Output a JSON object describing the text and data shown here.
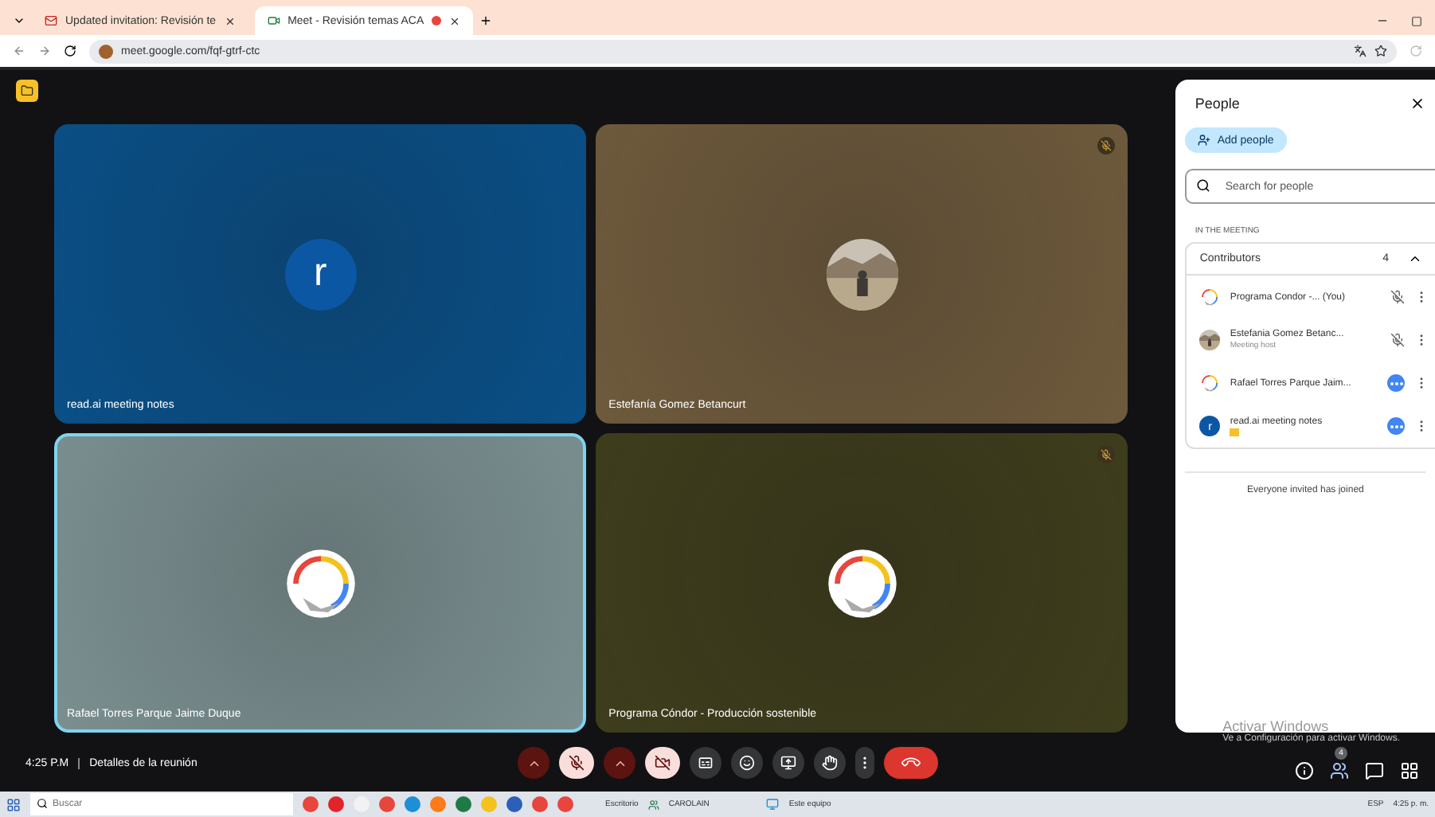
{
  "browser": {
    "tabs": [
      {
        "title": "Updated invitation: Revisión te",
        "selected": false
      },
      {
        "title": "Meet - Revisión temas ACA",
        "selected": true,
        "recording": true
      }
    ],
    "url": "meet.google.com/fqf-gtrf-ctc"
  },
  "tiles": [
    {
      "name": "read.ai meeting notes",
      "kind": "letter",
      "initial": "r",
      "active": false,
      "muted": false
    },
    {
      "name": "Estefanía Gomez Betancurt",
      "active": false,
      "muted": true
    },
    {
      "name": "Rafael Torres Parque Jaime Duque",
      "kind": "logo",
      "active": true,
      "muted": false
    },
    {
      "name": "Programa Cóndor - Producción sostenible",
      "kind": "logo",
      "active": false,
      "muted": true
    }
  ],
  "people_panel": {
    "title": "People",
    "add_button": "Add people",
    "search": {
      "placeholder": "Search for people"
    },
    "section": "IN THE MEETING",
    "group": {
      "label": "Contributors",
      "count": "4",
      "expanded": true
    },
    "participants": [
      {
        "name": "Programa Condor -...",
        "tag": "(You)",
        "kind": "logo",
        "muted": true,
        "speaking": false
      },
      {
        "name": "Estefania Gomez Betanc...",
        "subtitle": "Meeting host",
        "muted": true,
        "speaking": false
      },
      {
        "name": "Rafael Torres Parque Jaim...",
        "kind": "logo",
        "muted": false,
        "speaking": true
      },
      {
        "name": "read.ai meeting notes",
        "kind": "letter",
        "initial": "r",
        "muted": false,
        "speaking": true,
        "badge": true
      }
    ],
    "footer": "Everyone invited has joined"
  },
  "bottom_bar": {
    "time": "4:25 P.M",
    "details": "Detalles de la reunión",
    "controls": [
      {
        "kind": "caret",
        "alert": true
      },
      {
        "kind": "mic",
        "on": false
      },
      {
        "kind": "caret",
        "alert": true
      },
      {
        "kind": "camera",
        "on": false
      },
      {
        "kind": "captions"
      },
      {
        "kind": "emoji"
      },
      {
        "kind": "present"
      },
      {
        "kind": "hand"
      },
      {
        "kind": "more"
      },
      {
        "kind": "end"
      }
    ],
    "side_icons": [
      {
        "kind": "info",
        "selected": false
      },
      {
        "kind": "people",
        "selected": true,
        "badge": "4"
      },
      {
        "kind": "chat",
        "selected": false
      },
      {
        "kind": "apps",
        "selected": false
      }
    ]
  },
  "activation": {
    "title": "Activar Windows",
    "text": "Ve a Configuración para activar Windows."
  },
  "taskbar": {
    "search": {
      "placeholder": "Buscar"
    },
    "apps": [
      {
        "color": "#e8453c"
      },
      {
        "color": "#e3232a"
      },
      {
        "color": "#f2f2f2"
      },
      {
        "color": "#e8453c"
      },
      {
        "color": "#1c8fd8"
      },
      {
        "color": "#ff7a1a"
      },
      {
        "color": "#1f7a45"
      },
      {
        "color": "#f4c21b"
      },
      {
        "color": "#2b5fb8"
      },
      {
        "color": "#e8453c"
      },
      {
        "color": "#e8453c"
      }
    ],
    "items": [
      "Escritorio",
      "CAROLAIN",
      "Este equipo"
    ],
    "language": "ESP",
    "clock": "4:25 p. m."
  }
}
